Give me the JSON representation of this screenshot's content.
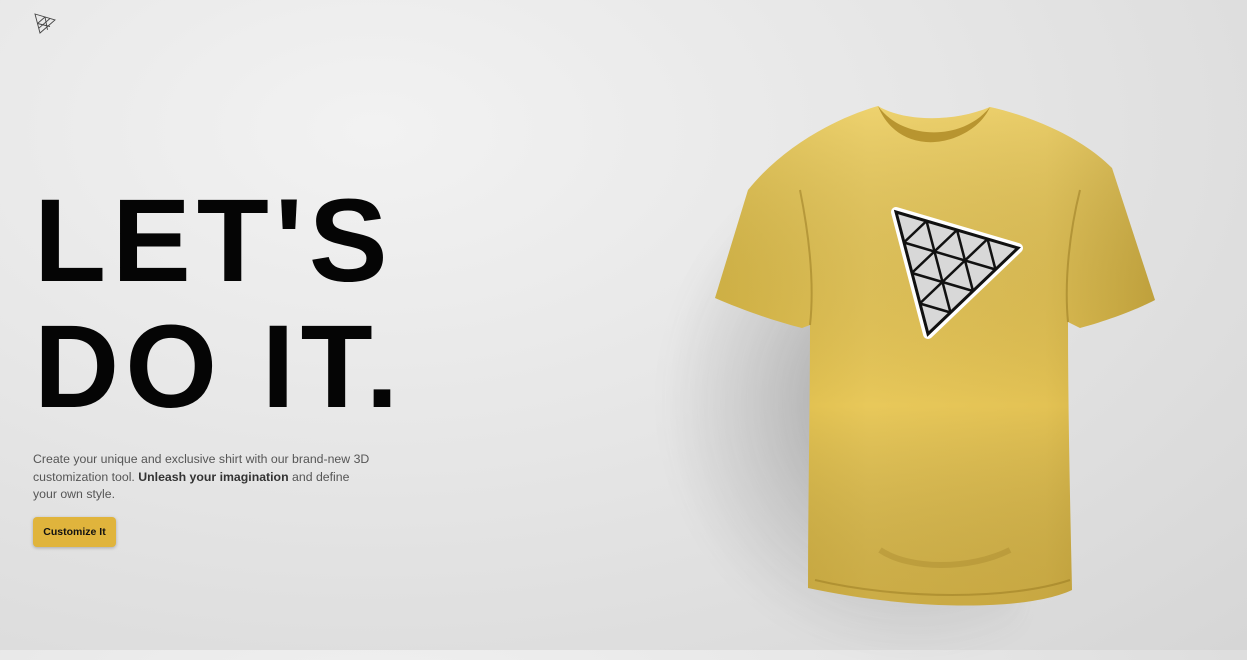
{
  "header": {
    "logo_icon": "threejs-triangle-logo-icon"
  },
  "hero": {
    "headline_line1": "LET'S",
    "headline_line2": "DO IT.",
    "description_part1": "Create your unique and exclusive shirt with our brand-new 3D customization tool. ",
    "description_bold": "Unleash your imagination",
    "description_part2": " and define your own style.",
    "cta_label": "Customize It"
  },
  "shirt": {
    "color": "#e8c85a",
    "decal_icon": "threejs-triangle-logo-icon"
  },
  "colors": {
    "accent": "#e0b43c",
    "text": "#050505",
    "background": "#e6e6e6"
  }
}
